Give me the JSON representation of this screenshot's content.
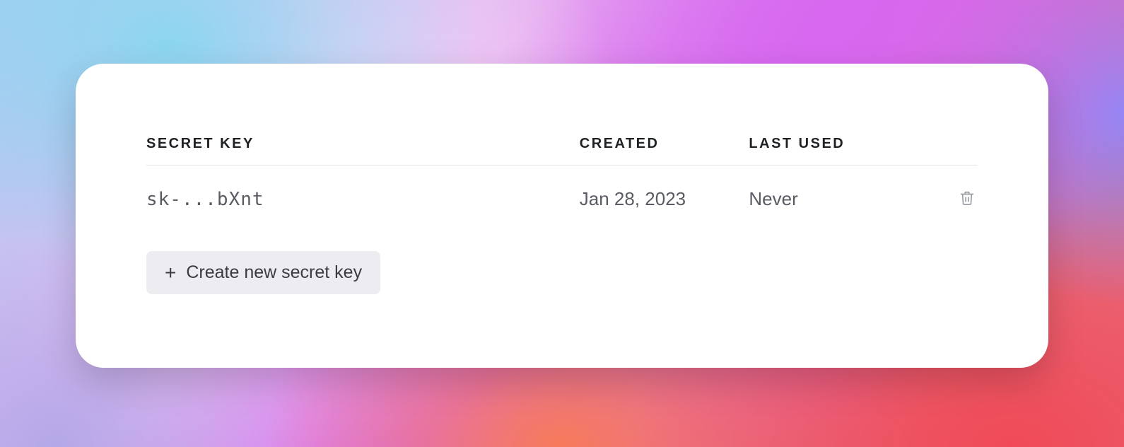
{
  "table": {
    "headers": {
      "secret_key": "SECRET KEY",
      "created": "CREATED",
      "last_used": "LAST USED"
    },
    "rows": [
      {
        "key": "sk-...bXnt",
        "created": "Jan 28, 2023",
        "last_used": "Never"
      }
    ]
  },
  "buttons": {
    "create_label": "Create new secret key"
  }
}
